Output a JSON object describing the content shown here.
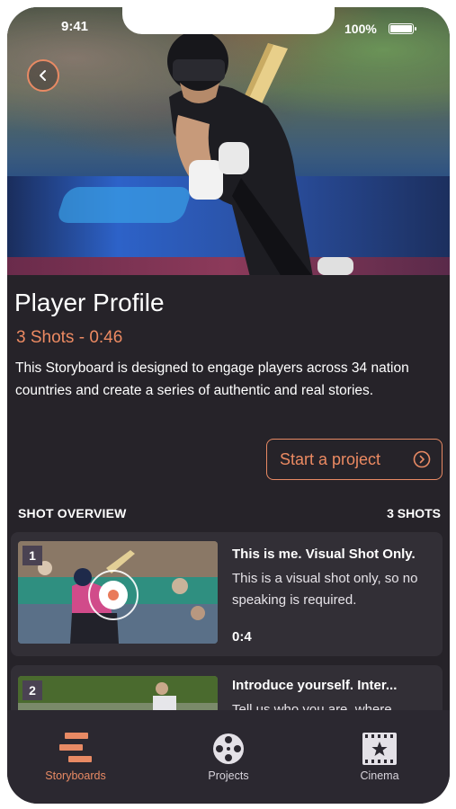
{
  "status_bar": {
    "time": "9:41",
    "battery": "100%"
  },
  "header": {
    "back_icon": "chevron-left-icon"
  },
  "profile": {
    "title": "Player Profile",
    "subtitle": "3 Shots - 0:46",
    "description": "This Storyboard is designed to engage players across 34 nation countries and create a series of authentic and real stories.",
    "cta_label": "Start a project"
  },
  "overview": {
    "label": "SHOT OVERVIEW",
    "count": "3 SHOTS"
  },
  "shots": [
    {
      "number": "1",
      "title": "This is me. Visual Shot Only.",
      "text": "This is a visual shot only, so no speaking is required.",
      "duration": "0:4"
    },
    {
      "number": "2",
      "title": "Introduce yourself. Inter...",
      "text": "Tell us who you are, where",
      "duration": ""
    }
  ],
  "tabs": [
    {
      "label": "Storyboards",
      "icon": "storyboards-icon",
      "active": true
    },
    {
      "label": "Projects",
      "icon": "film-reel-icon",
      "active": false
    },
    {
      "label": "Cinema",
      "icon": "cinema-ticket-icon",
      "active": false
    }
  ],
  "colors": {
    "accent": "#e88a64",
    "background": "#262329",
    "card": "#322f36"
  }
}
